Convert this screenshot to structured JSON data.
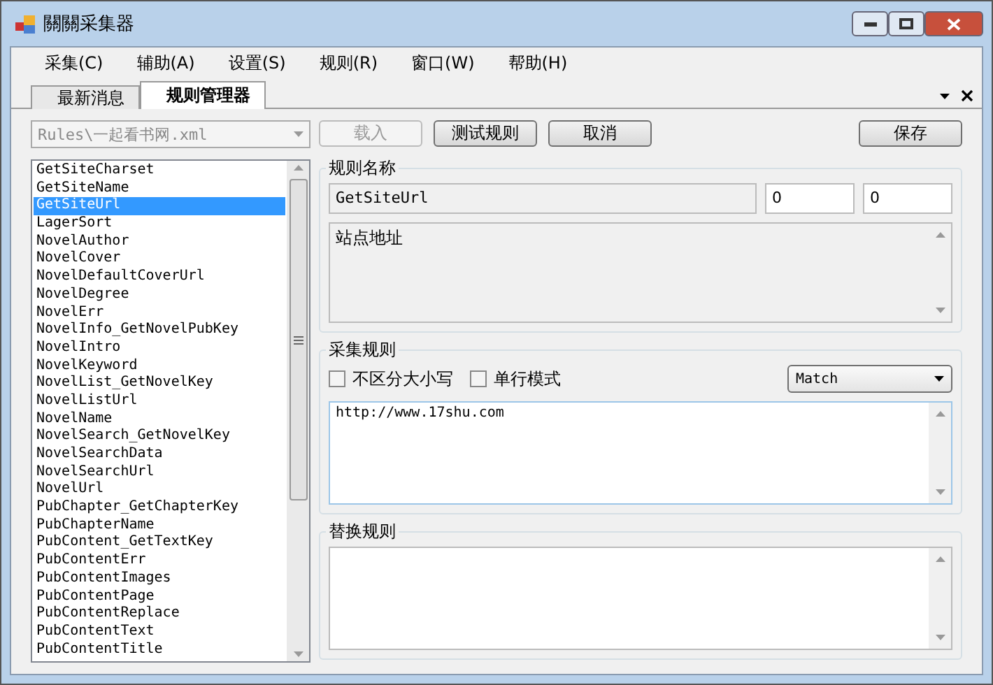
{
  "window": {
    "title": "關關采集器"
  },
  "menu": [
    "采集(C)",
    "辅助(A)",
    "设置(S)",
    "规则(R)",
    "窗口(W)",
    "帮助(H)"
  ],
  "tabs": [
    {
      "label": "最新消息",
      "selected": false
    },
    {
      "label": "规则管理器",
      "selected": true
    }
  ],
  "rule_file": {
    "value": "Rules\\一起看书网.xml",
    "disabled": true
  },
  "buttons": [
    {
      "label": "载入",
      "disabled": true
    },
    {
      "label": "测试规则",
      "disabled": false
    },
    {
      "label": "取消",
      "disabled": false
    }
  ],
  "save_button": "保存",
  "rules": [
    {
      "label": "GetSiteCharset",
      "selected": false
    },
    {
      "label": "GetSiteName",
      "selected": false
    },
    {
      "label": "GetSiteUrl",
      "selected": true
    },
    {
      "label": "LagerSort",
      "selected": false
    },
    {
      "label": "NovelAuthor",
      "selected": false
    },
    {
      "label": "NovelCover",
      "selected": false
    },
    {
      "label": "NovelDefaultCoverUrl",
      "selected": false
    },
    {
      "label": "NovelDegree",
      "selected": false
    },
    {
      "label": "NovelErr",
      "selected": false
    },
    {
      "label": "NovelInfo_GetNovelPubKey",
      "selected": false
    },
    {
      "label": "NovelIntro",
      "selected": false
    },
    {
      "label": "NovelKeyword",
      "selected": false
    },
    {
      "label": "NovelList_GetNovelKey",
      "selected": false
    },
    {
      "label": "NovelListUrl",
      "selected": false
    },
    {
      "label": "NovelName",
      "selected": false
    },
    {
      "label": "NovelSearch_GetNovelKey",
      "selected": false
    },
    {
      "label": "NovelSearchData",
      "selected": false
    },
    {
      "label": "NovelSearchUrl",
      "selected": false
    },
    {
      "label": "NovelUrl",
      "selected": false
    },
    {
      "label": "PubChapter_GetChapterKey",
      "selected": false
    },
    {
      "label": "PubChapterName",
      "selected": false
    },
    {
      "label": "PubContent_GetTextKey",
      "selected": false
    },
    {
      "label": "PubContentErr",
      "selected": false
    },
    {
      "label": "PubContentImages",
      "selected": false
    },
    {
      "label": "PubContentPage",
      "selected": false
    },
    {
      "label": "PubContentReplace",
      "selected": false
    },
    {
      "label": "PubContentText",
      "selected": false
    },
    {
      "label": "PubContentTitle",
      "selected": false
    }
  ],
  "rule_name": {
    "title": "规则名称",
    "name": "GetSiteUrl",
    "field_2": "0",
    "field_3": "0",
    "description": "站点地址"
  },
  "collect_rule": {
    "title": "采集规则",
    "options": [
      {
        "label": "不区分大小写",
        "checked": false
      },
      {
        "label": "单行模式",
        "checked": false
      }
    ],
    "mode": "Match",
    "pattern": "http://www.17shu.com"
  },
  "replace_rule": {
    "title": "替换规则"
  }
}
